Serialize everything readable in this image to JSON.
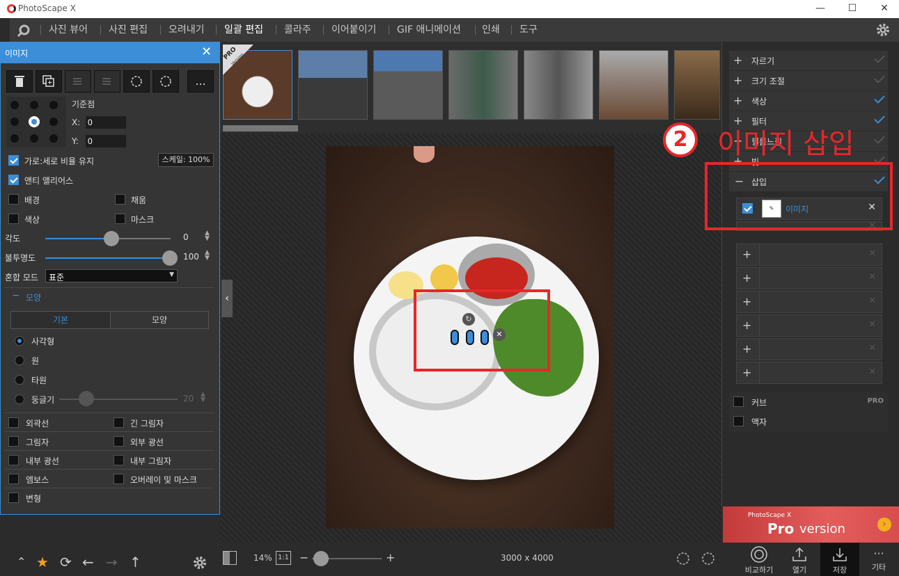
{
  "app": {
    "title": "PhotoScape X"
  },
  "window": {
    "minimize": "—",
    "maximize": "☐",
    "close": "✕"
  },
  "menu": {
    "items": [
      "사진 뷰어",
      "사진 편집",
      "오려내기",
      "일괄 편집",
      "콜라주",
      "이어붙이기",
      "GIF 애니메이션",
      "인쇄",
      "도구"
    ],
    "active": "일괄 편집"
  },
  "left_panel": {
    "header": "이미지",
    "more_label": "...",
    "anchor_label": "기준점",
    "x_label": "X:",
    "x_value": "0",
    "y_label": "Y:",
    "y_value": "0",
    "keep_ratio_label": "가로:세로 비율 유지",
    "scale_label": "스케일: 100%",
    "antialias_label": "앤티 앨리어스",
    "background_label": "배경",
    "fill_label": "채움",
    "color_label": "색상",
    "mask_label": "마스크",
    "angle_label": "각도",
    "angle_value": "0",
    "opacity_label": "불투명도",
    "opacity_value": "100",
    "blend_label": "혼합 모드",
    "blend_value": "표준",
    "shape_section": "모양",
    "tab_basic": "기본",
    "tab_shape": "모양",
    "shape_rect": "사각형",
    "shape_circle": "원",
    "shape_ellipse": "타원",
    "shape_rounded": "둥글기",
    "rounded_value": "20",
    "outer_line": "외곽선",
    "long_shadow": "긴 그림자",
    "shadow": "그림자",
    "outer_glow": "외부 광선",
    "inner_glow": "내부 광선",
    "inner_shadow": "내부 그림자",
    "emboss": "엠보스",
    "overlay_mask": "오버레이 및 마스크",
    "transform": "변형"
  },
  "filmstrip": {
    "pro_badge": "PRO",
    "pro_sub": "Version"
  },
  "bottom": {
    "zoom": "14%",
    "one_to_one": "1:1",
    "dimensions": "3000 x 4000"
  },
  "right_panel": {
    "items": [
      {
        "label": "자르기",
        "checked": false
      },
      {
        "label": "크기 조절",
        "checked": false
      },
      {
        "label": "색상",
        "checked": true
      },
      {
        "label": "필터",
        "checked": true
      },
      {
        "label": "필름느낌",
        "checked": false
      },
      {
        "label": "빛",
        "checked": false
      }
    ],
    "insert_label": "삽입",
    "insert_image_label": "이미지",
    "curve_label": "커브",
    "pro_tag": "PRO",
    "frame_label": "액자"
  },
  "pro_banner": {
    "brand": "PhotoScape X",
    "text": "Pro",
    "sub": "version"
  },
  "right_bottom": {
    "compare": "비교하기",
    "open": "열기",
    "save": "저장",
    "more": "기타"
  },
  "annotation": {
    "number": "2",
    "text": "이미지 삽입"
  },
  "colors": {
    "accent": "#3c8ed8",
    "annotation": "#e8262a"
  }
}
